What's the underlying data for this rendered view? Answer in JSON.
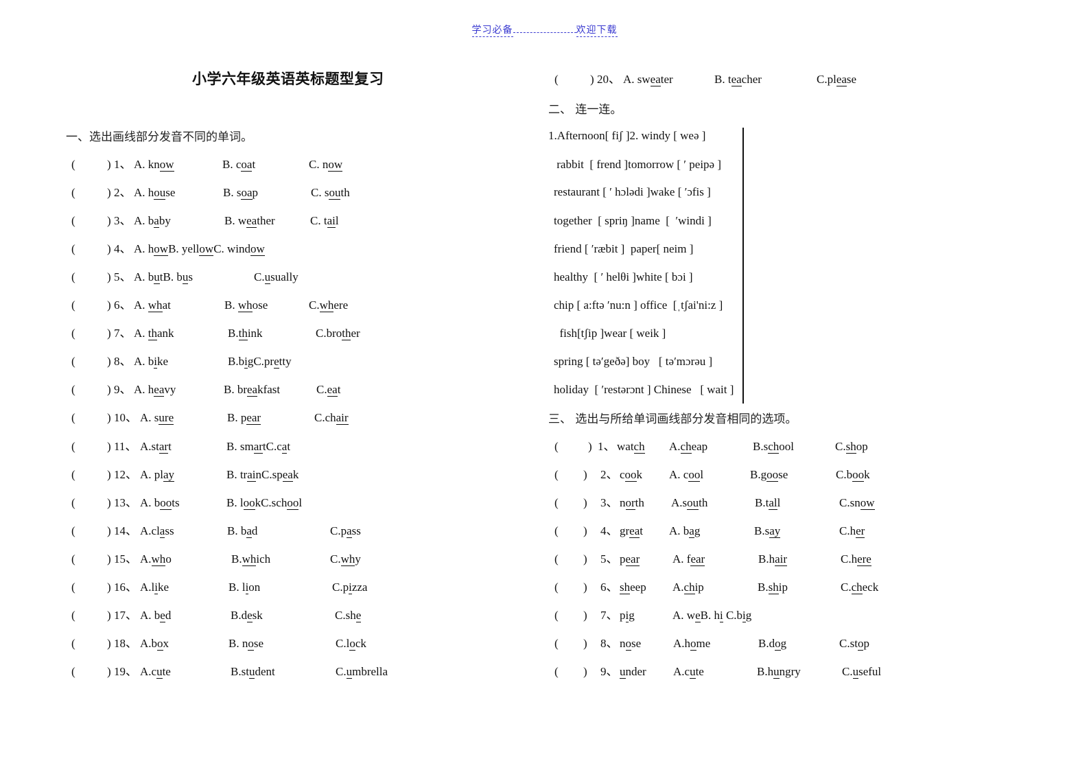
{
  "header": {
    "left": "学习必备",
    "right": "欢迎下载"
  },
  "title": "小学六年级英语英标题型复习",
  "section1": {
    "heading": "一、选出画线部分发音不同的单词。",
    "questions": [
      {
        "num": "1、",
        "a": [
          "A. kn",
          "ow",
          ""
        ],
        "b": [
          "B. c",
          "oa",
          "t"
        ],
        "c": [
          "C. n",
          "ow",
          ""
        ]
      },
      {
        "num": "2、",
        "a": [
          "A. h",
          "ou",
          "se"
        ],
        "b": [
          "B. s",
          "oa",
          "p"
        ],
        "c": [
          "C. s",
          "ou",
          "th"
        ]
      },
      {
        "num": "3、",
        "a": [
          "A. b",
          "a",
          "by"
        ],
        "b": [
          "B. w",
          "ea",
          "ther"
        ],
        "c": [
          "C. t",
          "ai",
          "l"
        ]
      },
      {
        "num": "4、",
        "inline": [
          [
            "A. h",
            "ow",
            ""
          ],
          [
            "B. yell",
            "ow",
            ""
          ],
          [
            "C. wind",
            "ow",
            ""
          ]
        ]
      },
      {
        "num": "5、",
        "inline": [
          [
            "A. b",
            "u",
            "t"
          ],
          [
            "B. b",
            "u",
            "s"
          ]
        ],
        "c": [
          "C.",
          "u",
          "sually"
        ]
      },
      {
        "num": "6、",
        "a": [
          "A. ",
          "wh",
          "at"
        ],
        "b": [
          "B. ",
          "wh",
          "ose"
        ],
        "c": [
          "C.",
          "wh",
          "ere"
        ]
      },
      {
        "num": "7、",
        "a": [
          "A. ",
          "th",
          "ank"
        ],
        "b": [
          "B.",
          "th",
          "ink"
        ],
        "c": [
          "C.bro",
          "th",
          "er"
        ]
      },
      {
        "num": "8、",
        "a": [
          "A. b",
          "i",
          "ke"
        ],
        "inline_b": [
          [
            "B.b",
            "i",
            "g"
          ],
          [
            "C.pr",
            "e",
            "tty"
          ]
        ]
      },
      {
        "num": "9、",
        "a": [
          "A. h",
          "ea",
          "vy"
        ],
        "b": [
          "B. br",
          "ea",
          "kfast"
        ],
        "c": [
          "C.",
          "ea",
          "t"
        ]
      },
      {
        "num": "10、",
        "a": [
          "A. s",
          "ure",
          ""
        ],
        "b": [
          "B. p",
          "ear",
          ""
        ],
        "c": [
          "C.ch",
          "air",
          ""
        ]
      },
      {
        "num": "11、",
        "a": [
          "A.st",
          "ar",
          "t"
        ],
        "inline_b": [
          [
            "B. sm",
            "ar",
            "t"
          ],
          [
            "C.c",
            "a",
            "t"
          ]
        ]
      },
      {
        "num": "12、",
        "a": [
          "A. pl",
          "ay",
          ""
        ],
        "inline_b": [
          [
            "B. tr",
            "ai",
            "n"
          ],
          [
            "C.sp",
            "ea",
            "k"
          ]
        ]
      },
      {
        "num": "13、",
        "a": [
          "A. b",
          "oo",
          "ts"
        ],
        "inline_b": [
          [
            "B. l",
            "oo",
            "k"
          ],
          [
            "C.sch",
            "oo",
            "l"
          ]
        ]
      },
      {
        "num": "14、",
        "a": [
          "A.cl",
          "a",
          "ss"
        ],
        "b": [
          "B. b",
          "a",
          "d"
        ],
        "c": [
          "C.p",
          "a",
          "ss"
        ]
      },
      {
        "num": "15、",
        "a": [
          "A.",
          "wh",
          "o"
        ],
        "b": [
          "B.",
          "wh",
          "ich"
        ],
        "c": [
          "C.",
          "wh",
          "y"
        ]
      },
      {
        "num": "16、",
        "a": [
          "A.l",
          "i",
          "ke"
        ],
        "b": [
          "B. l",
          "i",
          "on"
        ],
        "c": [
          "C.p",
          "i",
          "zza"
        ]
      },
      {
        "num": "17、",
        "a": [
          "A. b",
          "e",
          "d"
        ],
        "b": [
          "B.d",
          "e",
          "sk"
        ],
        "c": [
          "C.sh",
          "e",
          ""
        ]
      },
      {
        "num": "18、",
        "a": [
          "A.b",
          "o",
          "x"
        ],
        "b": [
          "B. n",
          "o",
          "se"
        ],
        "c": [
          "C.l",
          "o",
          "ck"
        ]
      },
      {
        "num": "19、",
        "a": [
          "A.c",
          "u",
          "te"
        ],
        "b": [
          "B.st",
          "u",
          "dent"
        ],
        "c": [
          "C.",
          "u",
          "mbrella"
        ]
      },
      {
        "num": "20、",
        "a": [
          "A. sw",
          "ea",
          "ter"
        ],
        "b": [
          "B. t",
          "ea",
          "cher"
        ],
        "c": [
          "C.pl",
          "ea",
          "se"
        ]
      }
    ]
  },
  "section2": {
    "heading": "二、  连一连。",
    "lines": [
      "1.Afternoon[ fiʃ ]2. windy [ weə ]",
      " rabbit  [ frend ]tomorrow [ ʹ peipə ]",
      "restaurant [ ʹ hɔlədi ]wake [ ʹɔfis ]",
      "together  [ spriŋ ]name  [  ʹwindi ]",
      "friend [ ʹræbit ]  paper[ neim ]",
      "healthy  [ ʹ helθi ]white [ bɔi ]",
      "chip [ a:ftə ʹnu:n ] office  [ˌtʃai'ni:z ]",
      "  fish[tʃip ]wear [ weik ]",
      "spring [ təʹgeðə] boy   [ təʹmɔrəu ]",
      "holiday  [ ʹrestərɔnt ] Chinese   [ wait ]"
    ]
  },
  "section3": {
    "heading": "三、  选出与所给单词画线部分发音相同的选项。",
    "questions": [
      {
        "num": "1、",
        "word": [
          "wat",
          "ch",
          ""
        ],
        "a": [
          "A.",
          "ch",
          "eap"
        ],
        "b": [
          "B.s",
          "ch",
          "ool"
        ],
        "c": [
          "C.",
          "sh",
          "op"
        ]
      },
      {
        "num": "2、",
        "word": [
          "c",
          "oo",
          "k"
        ],
        "a": [
          "A. c",
          "oo",
          "l"
        ],
        "b": [
          "B.g",
          "oo",
          "se"
        ],
        "c": [
          "C.b",
          "oo",
          "k"
        ]
      },
      {
        "num": "3、",
        "word": [
          "n",
          "or",
          "th"
        ],
        "a": [
          "A.s",
          "ou",
          "th"
        ],
        "b": [
          "B.t",
          "al",
          "l"
        ],
        "c": [
          "C.sn",
          "ow",
          ""
        ]
      },
      {
        "num": "4、",
        "word": [
          "gr",
          "ea",
          "t"
        ],
        "a": [
          "A. b",
          "a",
          "g"
        ],
        "b": [
          "B.s",
          "ay",
          ""
        ],
        "c": [
          "C.h",
          "er",
          ""
        ]
      },
      {
        "num": "5、",
        "word": [
          "p",
          "ear",
          ""
        ],
        "a": [
          "A. f",
          "ear",
          ""
        ],
        "b": [
          "B.h",
          "air",
          ""
        ],
        "c": [
          "C.h",
          "ere",
          ""
        ]
      },
      {
        "num": "6、",
        "word": [
          "",
          "sh",
          "eep"
        ],
        "a": [
          "A.",
          "ch",
          "ip"
        ],
        "b": [
          "B.",
          "sh",
          "ip"
        ],
        "c": [
          "C.",
          "ch",
          "eck"
        ]
      },
      {
        "num": "7、",
        "word": [
          "p",
          "i",
          "g"
        ],
        "inline": [
          [
            "A. w",
            "e",
            ""
          ],
          [
            "B. h",
            "i",
            " "
          ],
          [
            "C.b",
            "i",
            "g"
          ]
        ]
      },
      {
        "num": "8、",
        "word": [
          "n",
          "o",
          "se"
        ],
        "a": [
          "A.h",
          "o",
          "me"
        ],
        "b": [
          "B.d",
          "o",
          "g"
        ],
        "c": [
          "C.st",
          "o",
          "p"
        ]
      },
      {
        "num": "9、",
        "word": [
          "",
          "u",
          "nder"
        ],
        "a": [
          "A.c",
          "u",
          "te"
        ],
        "b": [
          "B.h",
          "u",
          "ngry"
        ],
        "c": [
          "C.",
          "u",
          "seful"
        ]
      }
    ]
  }
}
